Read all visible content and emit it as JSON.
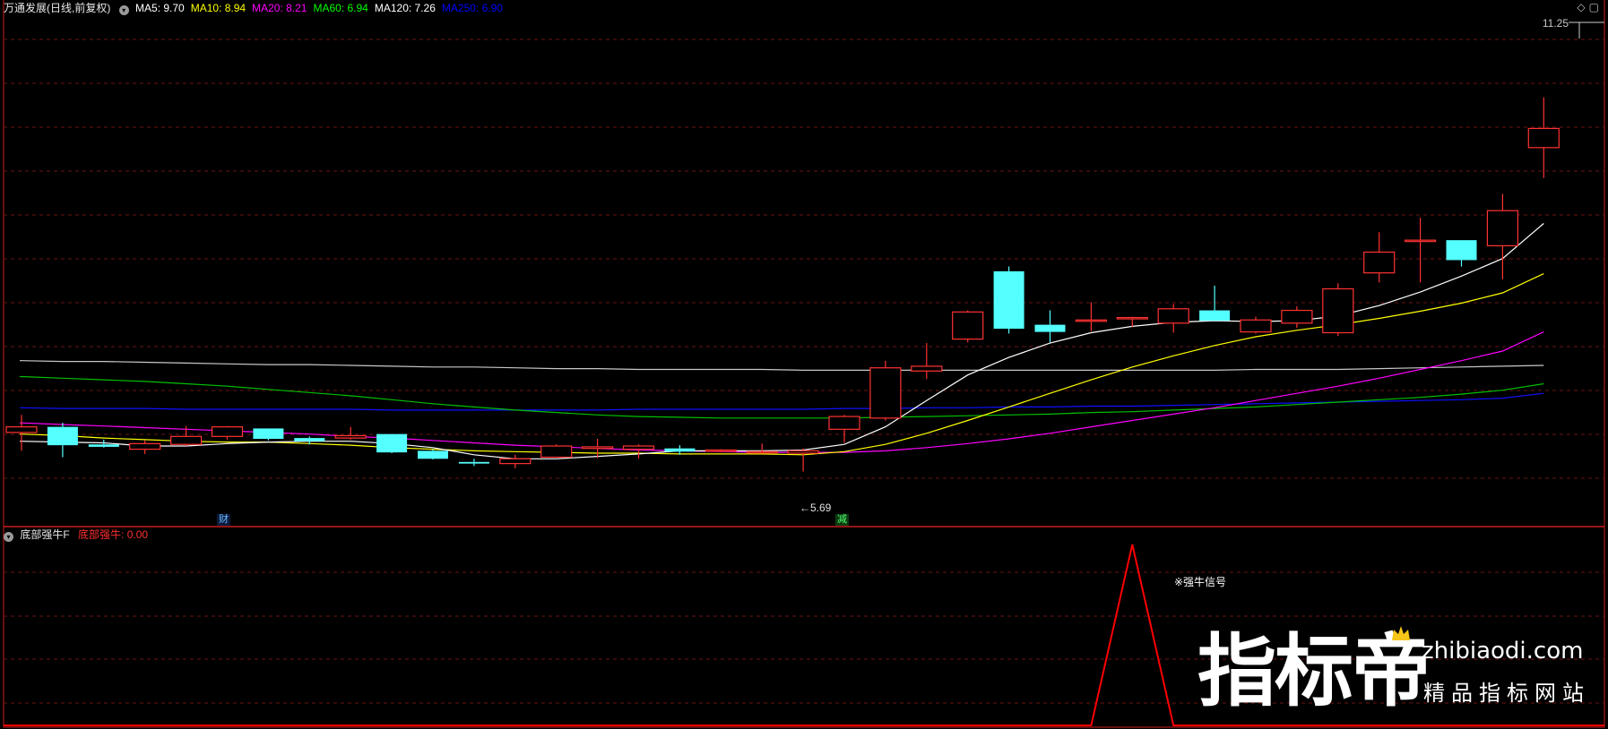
{
  "app": {
    "title": "万通发展(日线,前复权)",
    "top_right_icons": [
      "diamond-icon",
      "window-icon"
    ],
    "current_price_label": "11.25"
  },
  "main_panel": {
    "ma_legend": [
      {
        "label": "MA5: 9.70",
        "color": "#ffffff"
      },
      {
        "label": "MA10: 8.94",
        "color": "#ffff00"
      },
      {
        "label": "MA20: 8.21",
        "color": "#ff00ff"
      },
      {
        "label": "MA60: 6.94",
        "color": "#00ff00"
      },
      {
        "label": "MA120: 7.26",
        "color": "#ffffff"
      },
      {
        "label": "MA250: 6.90",
        "color": "#0000ff"
      }
    ],
    "low_marker": "←5.69",
    "badges": {
      "cai": "财",
      "jian": "减"
    }
  },
  "sub_panel": {
    "title": "底部强牛F",
    "indicator_label": "底部强牛: 0.00",
    "signal_label": "※强牛信号"
  },
  "watermark": {
    "main": "指标帝",
    "domain": "zhibiaodi.com",
    "slogan": "精品指标网站"
  },
  "colors": {
    "up_candle": "#ff3232",
    "down_candle": "#54ffff",
    "grid": "#6e1414",
    "separator": "#c81e1e",
    "indicator": "#ff0000"
  },
  "chart_data": [
    {
      "type": "candlestick",
      "title": "万通发展(日线,前复权)",
      "ylim": [
        5.0,
        11.6
      ],
      "candles": [
        {
          "o": 6.18,
          "h": 6.4,
          "l": 5.95,
          "c": 6.25
        },
        {
          "o": 6.25,
          "h": 6.3,
          "l": 5.87,
          "c": 6.02
        },
        {
          "o": 6.03,
          "h": 6.09,
          "l": 5.99,
          "c": 6.0
        },
        {
          "o": 5.97,
          "h": 6.08,
          "l": 5.91,
          "c": 6.04
        },
        {
          "o": 6.03,
          "h": 6.26,
          "l": 6.01,
          "c": 6.13
        },
        {
          "o": 6.13,
          "h": 6.26,
          "l": 6.09,
          "c": 6.25
        },
        {
          "o": 6.23,
          "h": 6.23,
          "l": 6.08,
          "c": 6.1
        },
        {
          "o": 6.11,
          "h": 6.13,
          "l": 6.03,
          "c": 6.07
        },
        {
          "o": 6.11,
          "h": 6.25,
          "l": 6.09,
          "c": 6.14
        },
        {
          "o": 6.16,
          "h": 6.16,
          "l": 5.92,
          "c": 5.93
        },
        {
          "o": 5.95,
          "h": 5.97,
          "l": 5.84,
          "c": 5.85
        },
        {
          "o": 5.81,
          "h": 5.85,
          "l": 5.76,
          "c": 5.79
        },
        {
          "o": 5.79,
          "h": 5.9,
          "l": 5.73,
          "c": 5.85
        },
        {
          "o": 5.87,
          "h": 6.03,
          "l": 5.87,
          "c": 6.01
        },
        {
          "o": 5.98,
          "h": 6.1,
          "l": 5.86,
          "c": 6.0
        },
        {
          "o": 5.97,
          "h": 6.03,
          "l": 5.85,
          "c": 6.01
        },
        {
          "o": 5.98,
          "h": 6.02,
          "l": 5.9,
          "c": 5.94
        },
        {
          "o": 5.95,
          "h": 5.97,
          "l": 5.93,
          "c": 5.96
        },
        {
          "o": 5.93,
          "h": 6.04,
          "l": 5.92,
          "c": 5.94
        },
        {
          "o": 5.92,
          "h": 5.98,
          "l": 5.69,
          "c": 5.95
        },
        {
          "o": 6.22,
          "h": 6.4,
          "l": 6.05,
          "c": 6.38
        },
        {
          "o": 6.36,
          "h": 7.08,
          "l": 6.33,
          "c": 6.99
        },
        {
          "o": 6.95,
          "h": 7.3,
          "l": 6.85,
          "c": 7.01
        },
        {
          "o": 7.35,
          "h": 7.71,
          "l": 7.31,
          "c": 7.69
        },
        {
          "o": 8.2,
          "h": 8.26,
          "l": 7.42,
          "c": 7.48
        },
        {
          "o": 7.53,
          "h": 7.71,
          "l": 7.31,
          "c": 7.44
        },
        {
          "o": 7.58,
          "h": 7.81,
          "l": 7.45,
          "c": 7.59
        },
        {
          "o": 7.61,
          "h": 7.63,
          "l": 7.5,
          "c": 7.62
        },
        {
          "o": 7.55,
          "h": 7.79,
          "l": 7.43,
          "c": 7.73
        },
        {
          "o": 7.71,
          "h": 8.02,
          "l": 7.62,
          "c": 7.58
        },
        {
          "o": 7.44,
          "h": 7.63,
          "l": 7.42,
          "c": 7.59
        },
        {
          "o": 7.55,
          "h": 7.76,
          "l": 7.49,
          "c": 7.71
        },
        {
          "o": 7.43,
          "h": 8.05,
          "l": 7.39,
          "c": 7.98
        },
        {
          "o": 8.18,
          "h": 8.69,
          "l": 8.06,
          "c": 8.44
        },
        {
          "o": 8.58,
          "h": 8.87,
          "l": 8.06,
          "c": 8.59
        },
        {
          "o": 8.59,
          "h": 8.59,
          "l": 8.26,
          "c": 8.34
        },
        {
          "o": 8.52,
          "h": 9.17,
          "l": 8.1,
          "c": 8.96
        },
        {
          "o": 9.75,
          "h": 10.38,
          "l": 9.37,
          "c": 9.99
        }
      ],
      "ma": {
        "MA5": [
          6.07,
          6.06,
          6.05,
          6.01,
          6.01,
          6.04,
          6.06,
          6.07,
          6.07,
          6.04,
          5.99,
          5.9,
          5.85,
          5.85,
          5.88,
          5.91,
          5.95,
          5.95,
          5.95,
          5.96,
          6.03,
          6.25,
          6.58,
          6.9,
          7.12,
          7.3,
          7.43,
          7.51,
          7.56,
          7.58,
          7.57,
          7.58,
          7.64,
          7.77,
          7.94,
          8.14,
          8.36,
          8.8
        ],
        "MA10": [
          6.16,
          6.14,
          6.11,
          6.09,
          6.07,
          6.06,
          6.06,
          6.04,
          6.02,
          5.99,
          5.97,
          5.95,
          5.94,
          5.93,
          5.92,
          5.92,
          5.91,
          5.91,
          5.91,
          5.9,
          5.94,
          6.03,
          6.17,
          6.33,
          6.5,
          6.67,
          6.84,
          7.0,
          7.14,
          7.27,
          7.38,
          7.46,
          7.53,
          7.61,
          7.7,
          7.8,
          7.93,
          8.17
        ],
        "MA20": [
          6.3,
          6.28,
          6.26,
          6.24,
          6.22,
          6.2,
          6.18,
          6.16,
          6.13,
          6.11,
          6.08,
          6.05,
          6.02,
          6.0,
          5.98,
          5.96,
          5.95,
          5.94,
          5.93,
          5.93,
          5.93,
          5.95,
          5.99,
          6.04,
          6.1,
          6.17,
          6.25,
          6.33,
          6.41,
          6.49,
          6.58,
          6.67,
          6.76,
          6.86,
          6.97,
          7.08,
          7.2,
          7.44
        ],
        "MA60": [
          6.88,
          6.86,
          6.84,
          6.82,
          6.79,
          6.76,
          6.72,
          6.68,
          6.64,
          6.59,
          6.54,
          6.5,
          6.46,
          6.43,
          6.4,
          6.38,
          6.37,
          6.36,
          6.36,
          6.36,
          6.36,
          6.37,
          6.38,
          6.39,
          6.4,
          6.41,
          6.43,
          6.44,
          6.46,
          6.48,
          6.5,
          6.53,
          6.56,
          6.59,
          6.62,
          6.66,
          6.71,
          6.79
        ],
        "MA120": [
          7.08,
          7.07,
          7.07,
          7.06,
          7.05,
          7.04,
          7.03,
          7.03,
          7.02,
          7.01,
          7.0,
          7.0,
          6.99,
          6.98,
          6.98,
          6.97,
          6.97,
          6.97,
          6.97,
          6.96,
          6.96,
          6.96,
          6.96,
          6.96,
          6.96,
          6.96,
          6.96,
          6.96,
          6.96,
          6.96,
          6.97,
          6.97,
          6.97,
          6.98,
          6.99,
          7.0,
          7.01,
          7.02
        ],
        "MA250": [
          6.49,
          6.48,
          6.48,
          6.48,
          6.47,
          6.47,
          6.47,
          6.47,
          6.47,
          6.46,
          6.46,
          6.46,
          6.46,
          6.46,
          6.46,
          6.47,
          6.47,
          6.47,
          6.47,
          6.47,
          6.48,
          6.48,
          6.49,
          6.49,
          6.5,
          6.5,
          6.51,
          6.51,
          6.52,
          6.53,
          6.54,
          6.55,
          6.56,
          6.57,
          6.58,
          6.59,
          6.61,
          6.67
        ]
      }
    },
    {
      "type": "line",
      "title": "底部强牛F",
      "series": [
        {
          "name": "底部强牛",
          "values": [
            0,
            0,
            0,
            0,
            0,
            0,
            0,
            0,
            0,
            0,
            0,
            0,
            0,
            0,
            0,
            0,
            0,
            0,
            0,
            0,
            0,
            0,
            0,
            0,
            0,
            0,
            0,
            1,
            0,
            0,
            0,
            0,
            0,
            0,
            0,
            0,
            0,
            0
          ]
        }
      ],
      "ylim": [
        0,
        1.1
      ]
    }
  ]
}
